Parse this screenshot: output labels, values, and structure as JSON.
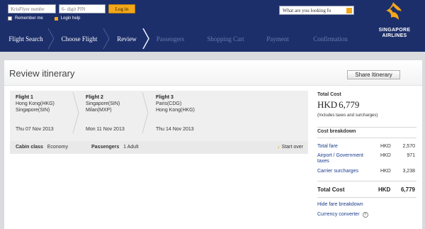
{
  "header": {
    "login": {
      "krisflyer_placeholder": "KrisFlyer numbe",
      "pin_placeholder": "6- digit PIN",
      "login_label": "Log in",
      "remember_label": "Remember me",
      "help_label": "Login help"
    },
    "search_placeholder": "What are you looking fo",
    "logo_line1": "SINGAPORE",
    "logo_line2": "AIRLINES",
    "steps": [
      {
        "label": "Flight Search",
        "state": "done"
      },
      {
        "label": "Choose Flight",
        "state": "done"
      },
      {
        "label": "Review",
        "state": "active"
      },
      {
        "label": "Passengers",
        "state": "todo"
      },
      {
        "label": "Shopping Cart",
        "state": "todo"
      },
      {
        "label": "Payment",
        "state": "todo"
      },
      {
        "label": "Confirmation",
        "state": "todo"
      }
    ],
    "colors": {
      "navy": "#1d2f6b",
      "accent": "#f3a71a"
    }
  },
  "page": {
    "title": "Review itinerary",
    "share_label": "Share Itinerary"
  },
  "flights": [
    {
      "title": "Flight 1",
      "from": "Hong Kong(HKG)",
      "to": "Singapore(SIN)",
      "date": "Thu 07 Nov 2013"
    },
    {
      "title": "Flight 2",
      "from": "Singapore(SIN)",
      "to": "Milan(MXP)",
      "date": "Mon 11 Nov 2013"
    },
    {
      "title": "Flight 3",
      "from": "Paris(CDG)",
      "to": "Hong Kong(HKG)",
      "date": "Thu 14 Nov 2013"
    }
  ],
  "summary": {
    "cabin_label": "Cabin class",
    "cabin_value": "Economy",
    "passengers_label": "Passengers",
    "passengers_value": "1 Adult",
    "start_over": "Start over"
  },
  "cost": {
    "total_label": "Total Cost",
    "currency": "HKD",
    "amount": "6,779",
    "includes_note": "(Includes taxes and surcharges)",
    "breakdown_label": "Cost breakdown",
    "rows": [
      {
        "label": "Total fare",
        "currency": "HKD",
        "value": "2,570"
      },
      {
        "label": "Airport / Government taxes",
        "currency": "HKD",
        "value": "971"
      },
      {
        "label": "Carrier surcharges",
        "currency": "HKD",
        "value": "3,238"
      }
    ],
    "total_row": {
      "label": "Total Cost",
      "currency": "HKD",
      "value": "6,779"
    },
    "hide_link": "Hide fare breakdown",
    "converter_link": "Currency converter",
    "help_icon_glyph": "?"
  }
}
